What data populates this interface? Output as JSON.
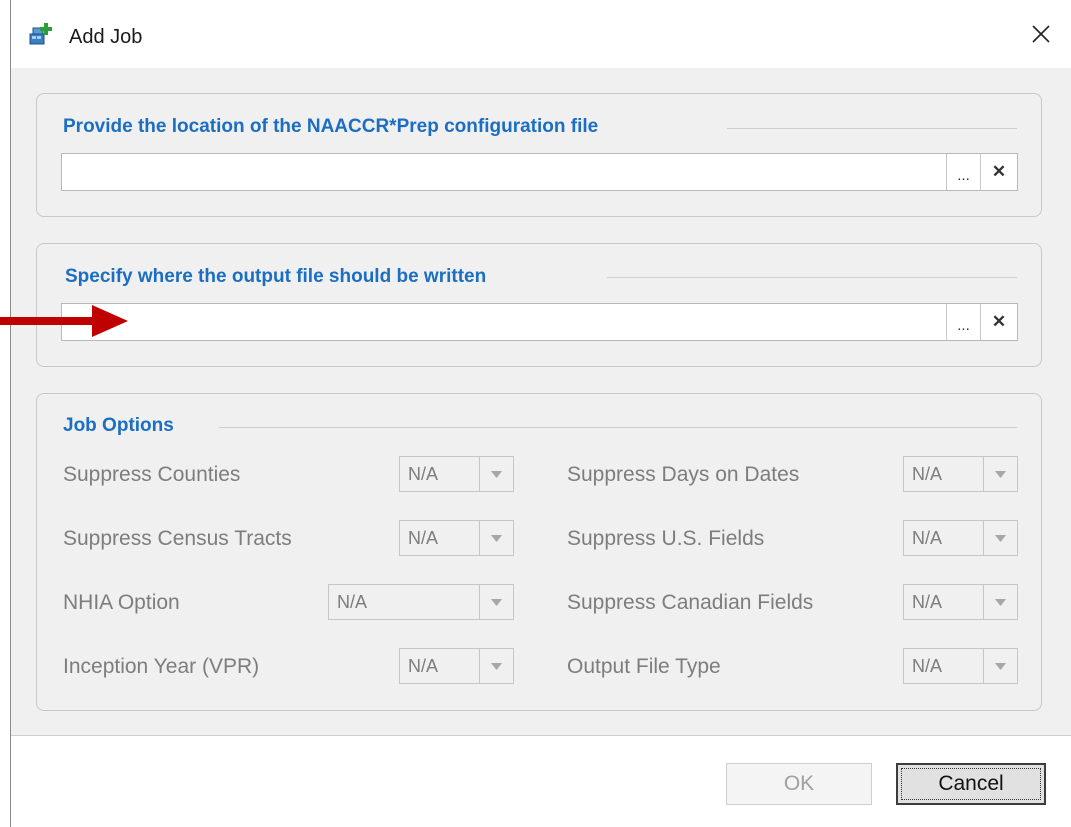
{
  "window": {
    "title": "Add Job",
    "icon": "add-job-icon",
    "close_icon": "close-icon"
  },
  "config_section": {
    "title": "Provide the location of the NAACCR*Prep configuration file",
    "value": "",
    "browse_label": "...",
    "clear_label": "✕"
  },
  "output_section": {
    "title": "Specify where the output file should be written",
    "value": "",
    "browse_label": "...",
    "clear_label": "✕"
  },
  "job_options": {
    "title": "Job Options",
    "left": [
      {
        "label": "Suppress Counties",
        "value": "N/A"
      },
      {
        "label": "Suppress Census Tracts",
        "value": "N/A"
      },
      {
        "label": "NHIA Option",
        "value": "N/A"
      },
      {
        "label": "Inception Year (VPR)",
        "value": "N/A"
      }
    ],
    "right": [
      {
        "label": "Suppress Days on Dates",
        "value": "N/A"
      },
      {
        "label": "Suppress U.S. Fields",
        "value": "N/A"
      },
      {
        "label": "Suppress Canadian Fields",
        "value": "N/A"
      },
      {
        "label": "Output File Type",
        "value": "N/A"
      }
    ]
  },
  "buttons": {
    "ok": "OK",
    "cancel": "Cancel"
  },
  "colors": {
    "section_title": "#1b6ec2",
    "annotation_arrow": "#c00000",
    "disabled_text": "#7d7d7d"
  }
}
